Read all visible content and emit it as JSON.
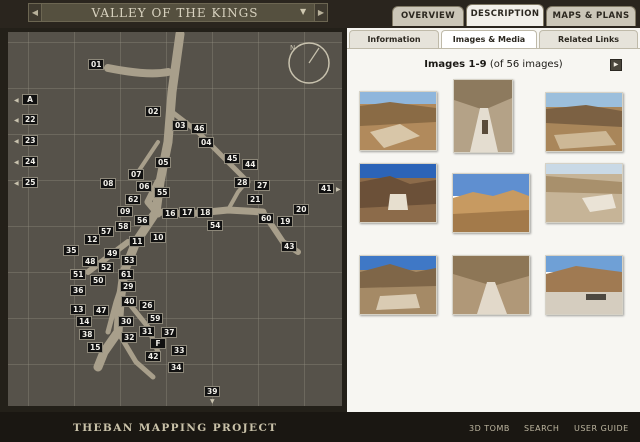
{
  "header": {
    "site_title": "VALLEY OF THE KINGS",
    "tabs": [
      {
        "label": "OVERVIEW",
        "active": false
      },
      {
        "label": "DESCRIPTION",
        "active": true
      },
      {
        "label": "MAPS & PLANS",
        "active": false
      }
    ]
  },
  "map": {
    "compass_label": "N",
    "tombs": [
      "01",
      "02",
      "03",
      "46",
      "04",
      "45",
      "44",
      "05",
      "07",
      "06",
      "55",
      "08",
      "28",
      "27",
      "62",
      "21",
      "09",
      "56",
      "16",
      "17",
      "18",
      "54",
      "60",
      "19",
      "20",
      "41",
      "57",
      "58",
      "12",
      "11",
      "10",
      "43",
      "35",
      "49",
      "48",
      "53",
      "52",
      "51",
      "61",
      "50",
      "29",
      "36",
      "40",
      "26",
      "13",
      "47",
      "59",
      "14",
      "30",
      "31",
      "37",
      "38",
      "32",
      "F",
      "33",
      "15",
      "42",
      "34",
      "39"
    ],
    "left_markers": [
      "A",
      "22",
      "23",
      "24",
      "25"
    ]
  },
  "content": {
    "subtabs": [
      {
        "label": "Information",
        "active": false
      },
      {
        "label": "Images & Media",
        "active": true
      },
      {
        "label": "Related Links",
        "active": false
      }
    ],
    "images_range": "Images 1-9",
    "images_total": "(of 56 images)"
  },
  "footer": {
    "project_title": "THEBAN MAPPING PROJECT",
    "links": [
      "3D TOMB",
      "SEARCH",
      "USER GUIDE"
    ]
  },
  "colors": {
    "map_background": "#56524a",
    "wadi_path": "#a89f8b",
    "tomb_label_bg": "#111111",
    "panel_background": "#f7f6f2"
  }
}
